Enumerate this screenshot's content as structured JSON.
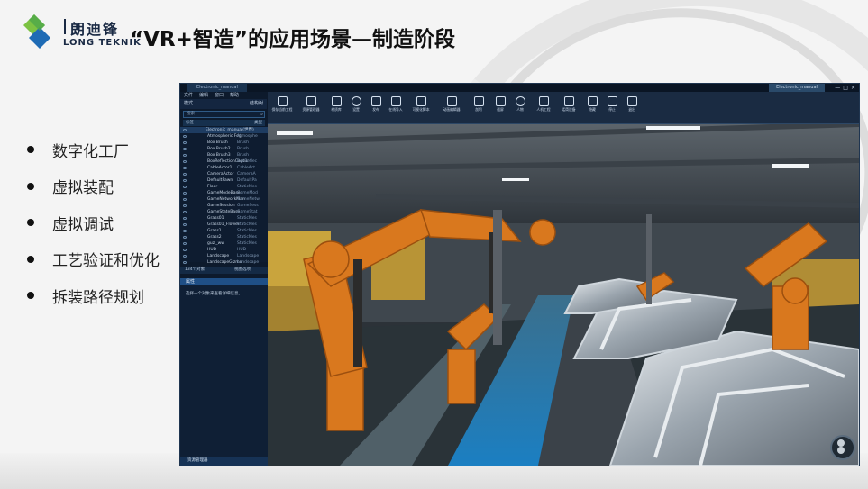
{
  "brand": {
    "cn": "朗迪锋",
    "en": "LONG TEKNIK"
  },
  "slide_title": "“VR+智造”的应用场景—制造阶段",
  "bullets": [
    "数字化工厂",
    "虚拟装配",
    "虚拟调试",
    "工艺验证和优化",
    "拆装路径规划"
  ],
  "app": {
    "doc_tab": "Electronic_manual",
    "right_tab": "Electronic_manual",
    "win_buttons": [
      "—",
      "□",
      "×"
    ],
    "menu": [
      "文件",
      "编辑",
      "窗口",
      "帮助"
    ],
    "panel_tabs": [
      "模式",
      "结构树"
    ],
    "search_placeholder": "搜索",
    "columns": [
      "标签",
      "类型"
    ],
    "outliner": [
      {
        "name": "Electronic_manual(世界)",
        "type": ""
      },
      {
        "name": "Atmospheric Fog",
        "type": "Atmosphe"
      },
      {
        "name": "Box Brush",
        "type": "Brush"
      },
      {
        "name": "Box Brush2",
        "type": "Brush"
      },
      {
        "name": "Box Brush3",
        "type": "Brush"
      },
      {
        "name": "BoxReflectionCaptur",
        "type": "BoxReflec"
      },
      {
        "name": "CableActor1",
        "type": "CableAct"
      },
      {
        "name": "CameraActor",
        "type": "CameraA"
      },
      {
        "name": "DefaultPawn",
        "type": "DefaultPa"
      },
      {
        "name": "Floor",
        "type": "StaticMes"
      },
      {
        "name": "GameModeBase",
        "type": "GameMod"
      },
      {
        "name": "GameNetworkMan",
        "type": "GameNetw"
      },
      {
        "name": "GameSession",
        "type": "GameSess"
      },
      {
        "name": "GameStateBase",
        "type": "GameStat"
      },
      {
        "name": "Grass01",
        "type": "StaticMes"
      },
      {
        "name": "Grass01_Flower",
        "type": "StaticMes"
      },
      {
        "name": "Grass1",
        "type": "StaticMes"
      },
      {
        "name": "Grass2",
        "type": "StaticMes"
      },
      {
        "name": "guzi_ww",
        "type": "StaticMes"
      },
      {
        "name": "HUD",
        "type": "HUD"
      },
      {
        "name": "Landscape",
        "type": "Landscape"
      },
      {
        "name": "LandscapeGizmo",
        "type": "Landscape"
      }
    ],
    "status_count": "134个对象",
    "status_view": "视图选项",
    "props_header": "属性",
    "props_msg": "选择一个对象来查看详细信息。",
    "bottom_bar": "资源管理器",
    "toolbar": [
      "保存当前工程",
      "资源管理器",
      "材质库",
      "设置",
      "发布",
      "在线导入",
      "可视化脚本",
      "动画编辑器",
      "剖切",
      "截屏",
      "人物",
      "人机工程",
      "话筒设备",
      "隐藏",
      "停止",
      "退出"
    ]
  },
  "colors": {
    "app_bg": "#0d1a2c",
    "toolbar_bg": "#1a2b42",
    "robot": "#d9781e",
    "floor_blue": "#1b7fc2"
  }
}
